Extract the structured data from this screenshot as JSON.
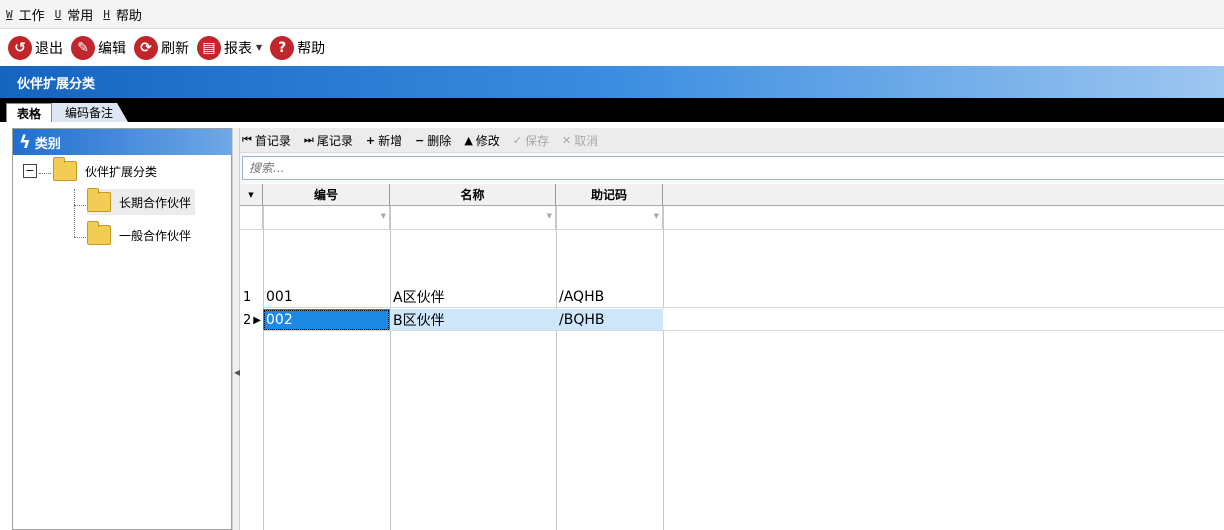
{
  "menu": [
    {
      "key": "W",
      "label": "工作"
    },
    {
      "key": "U",
      "label": "常用"
    },
    {
      "key": "H",
      "label": "帮助"
    }
  ],
  "toolbar": {
    "exit_label": "退出",
    "edit_label": "编辑",
    "refresh_label": "刷新",
    "report_label": "报表",
    "help_label": "帮助"
  },
  "window_title": "伙伴扩展分类",
  "tabs": [
    {
      "label": "表格",
      "active": true
    },
    {
      "label": "编码备注",
      "active": false
    }
  ],
  "tree": {
    "header": "类别",
    "root": "伙伴扩展分类",
    "children": [
      "长期合作伙伴",
      "一般合作伙伴"
    ],
    "selected_index": 0
  },
  "grid_toolbar": {
    "first": "首记录",
    "last": "尾记录",
    "add": "新增",
    "delete": "删除",
    "modify": "修改",
    "save": "保存",
    "cancel": "取消"
  },
  "search": {
    "placeholder": "搜索..."
  },
  "grid": {
    "columns": [
      "编号",
      "名称",
      "助记码"
    ],
    "rows": [
      {
        "index": "1",
        "code": "001",
        "name": "A区伙伴",
        "mnemonic": "/AQHB"
      },
      {
        "index": "2",
        "code": "002",
        "name": "B区伙伴",
        "mnemonic": "/BQHB"
      }
    ],
    "selected_row": 1
  },
  "colors": {
    "title_blue": "#1565c0",
    "icon_red": "#c0262c",
    "selection_blue": "#1e88e5",
    "row_highlight": "#cfe7fb"
  }
}
